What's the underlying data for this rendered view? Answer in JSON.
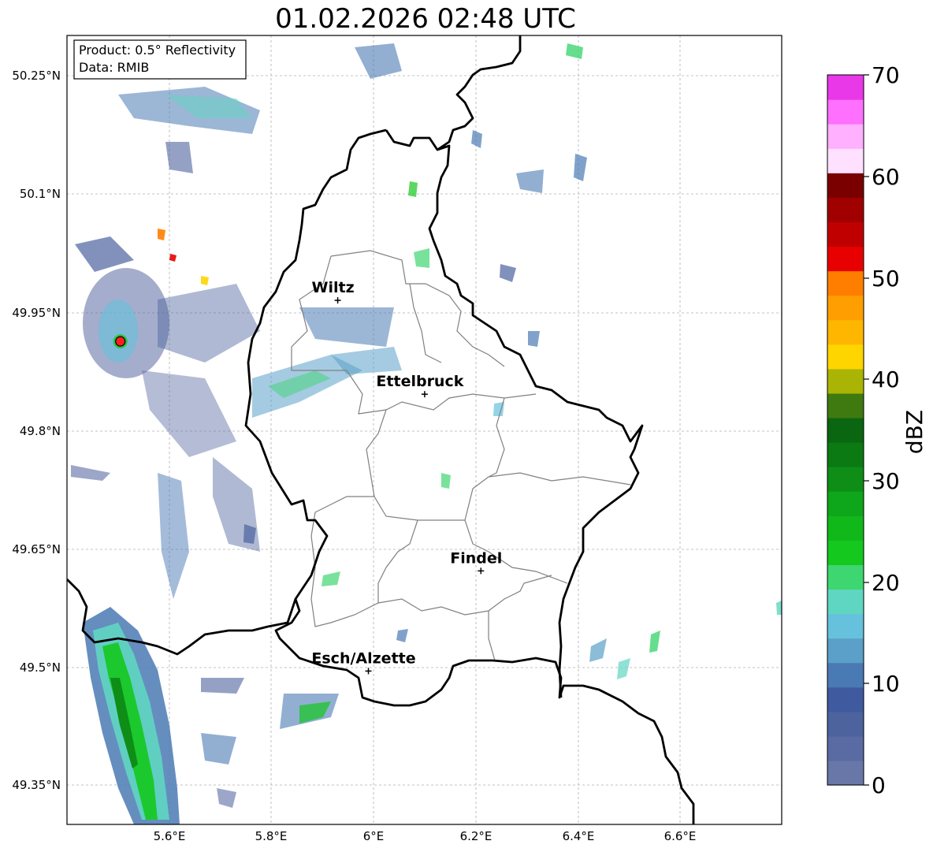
{
  "title": "01.02.2026 02:48 UTC",
  "info": {
    "product": "Product: 0.5° Reflectivity",
    "data": "Data: RMIB"
  },
  "lat_ticks": [
    "50.25°N",
    "50.1°N",
    "49.95°N",
    "49.8°N",
    "49.65°N",
    "49.5°N",
    "49.35°N"
  ],
  "lon_ticks": [
    "5.6°E",
    "5.8°E",
    "6°E",
    "6.2°E",
    "6.4°E",
    "6.6°E"
  ],
  "colorbar": {
    "label": "dBZ",
    "ticks": [
      "70",
      "60",
      "50",
      "40",
      "30",
      "20",
      "10",
      "0"
    ],
    "colors": [
      "#6877a8",
      "#5a6aa3",
      "#4d639e",
      "#405aa0",
      "#4a7ab4",
      "#5aa0c8",
      "#66c2dc",
      "#5fd6c2",
      "#3ed671",
      "#14c81e",
      "#10b81a",
      "#0ea61a",
      "#0e8e16",
      "#0c7a12",
      "#0a6610",
      "#3f7a10",
      "#aab404",
      "#ffd500",
      "#ffb600",
      "#ff9e00",
      "#ff7e00",
      "#e80000",
      "#c00000",
      "#a00000",
      "#7a0000",
      "#ffe0ff",
      "#ffb0ff",
      "#ff70ff",
      "#e838e8"
    ]
  },
  "cities": [
    {
      "name": "Wiltz",
      "lon": 5.93,
      "lat": 49.966
    },
    {
      "name": "Ettelbruck",
      "lon": 6.1,
      "lat": 49.847
    },
    {
      "name": "Findel",
      "lon": 6.21,
      "lat": 49.623
    },
    {
      "name": "Esch/Alzette",
      "lon": 5.99,
      "lat": 49.496
    }
  ],
  "radar_site": {
    "lon": 5.505,
    "lat": 49.914
  },
  "colors": {
    "border": "#000000",
    "canton": "#808080",
    "grid": "#b0b0b0",
    "radar_site": "#ff1f1f"
  }
}
